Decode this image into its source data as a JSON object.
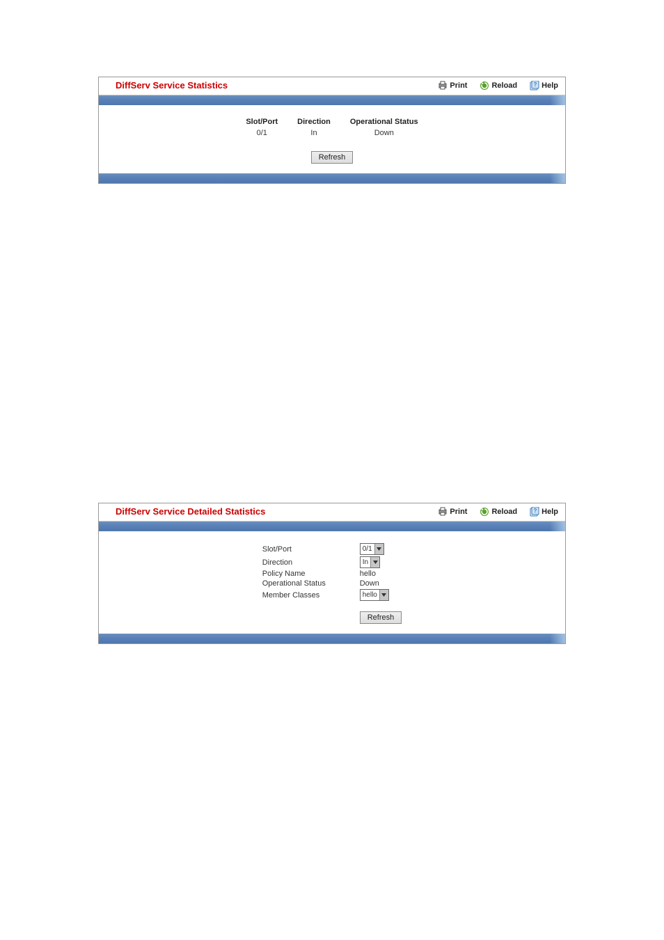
{
  "toolbar": {
    "print": "Print",
    "reload": "Reload",
    "help": "Help"
  },
  "panel1": {
    "title": "DiffServ Service Statistics",
    "columns": {
      "slot_port": "Slot/Port",
      "direction": "Direction",
      "op_status": "Operational Status"
    },
    "row": {
      "slot_port": "0/1",
      "direction": "In",
      "op_status": "Down"
    },
    "refresh": "Refresh"
  },
  "panel2": {
    "title": "DiffServ Service Detailed Statistics",
    "labels": {
      "slot_port": "Slot/Port",
      "direction": "Direction",
      "policy_name": "Policy Name",
      "op_status": "Operational Status",
      "member_classes": "Member Classes"
    },
    "values": {
      "slot_port": "0/1",
      "direction": "In",
      "policy_name": "hello",
      "op_status": "Down",
      "member_classes": "hello"
    },
    "refresh": "Refresh"
  }
}
